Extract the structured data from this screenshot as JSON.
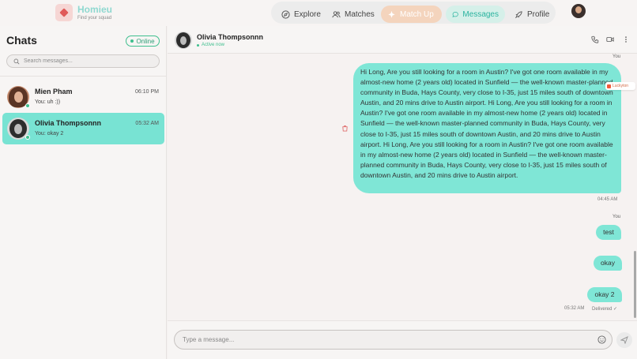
{
  "brand": {
    "name": "Homieu",
    "tagline": "Find your squad"
  },
  "nav": {
    "explore": "Explore",
    "matches": "Matches",
    "match_up": "Match Up",
    "messages": "Messages",
    "profile": "Profile"
  },
  "sidebar": {
    "title": "Chats",
    "status": "Online",
    "search_placeholder": "Search messages...",
    "chats": [
      {
        "name": "Mien Pham",
        "last": "You: uh :))",
        "time": "06:10 PM"
      },
      {
        "name": "Olivia Thompsonnn",
        "last": "You: okay 2",
        "time": "05:32 AM"
      }
    ]
  },
  "header": {
    "name": "Olivia Thompsonnn",
    "status": "Active now"
  },
  "messages": {
    "you_label": "You",
    "long_text": "Hi Long, Are you still looking for a room in Austin? I've got one room available in my almost-new home (2 years old) located in Sunfield — the well-known master-planned community in Buda, Hays County, very close to I-35, just 15 miles south of downtown Austin, and 20 mins drive to Austin airport. Hi Long, Are you still looking for a room in Austin? I've got one room available in my almost-new home (2 years old) located in Sunfield — the well-known master-planned community in Buda, Hays County, very close to I-35, just 15 miles south of downtown Austin, and 20 mins drive to Austin airport. Hi Long, Are you still looking for a room in Austin? I've got one room available in my almost-new home (2 years old) located in Sunfield — the well-known master-planned community in Buda, Hays County, very close to I-35, just 15 miles south of downtown Austin, and 20 mins drive to Austin airport.",
    "long_time": "04:45 AM",
    "badge": "Luckyton",
    "test": "test",
    "okay": "okay",
    "okay2": "okay 2",
    "last_time": "05:32 AM",
    "delivered": "Delivered ✓"
  },
  "composer": {
    "placeholder": "Type a message..."
  }
}
